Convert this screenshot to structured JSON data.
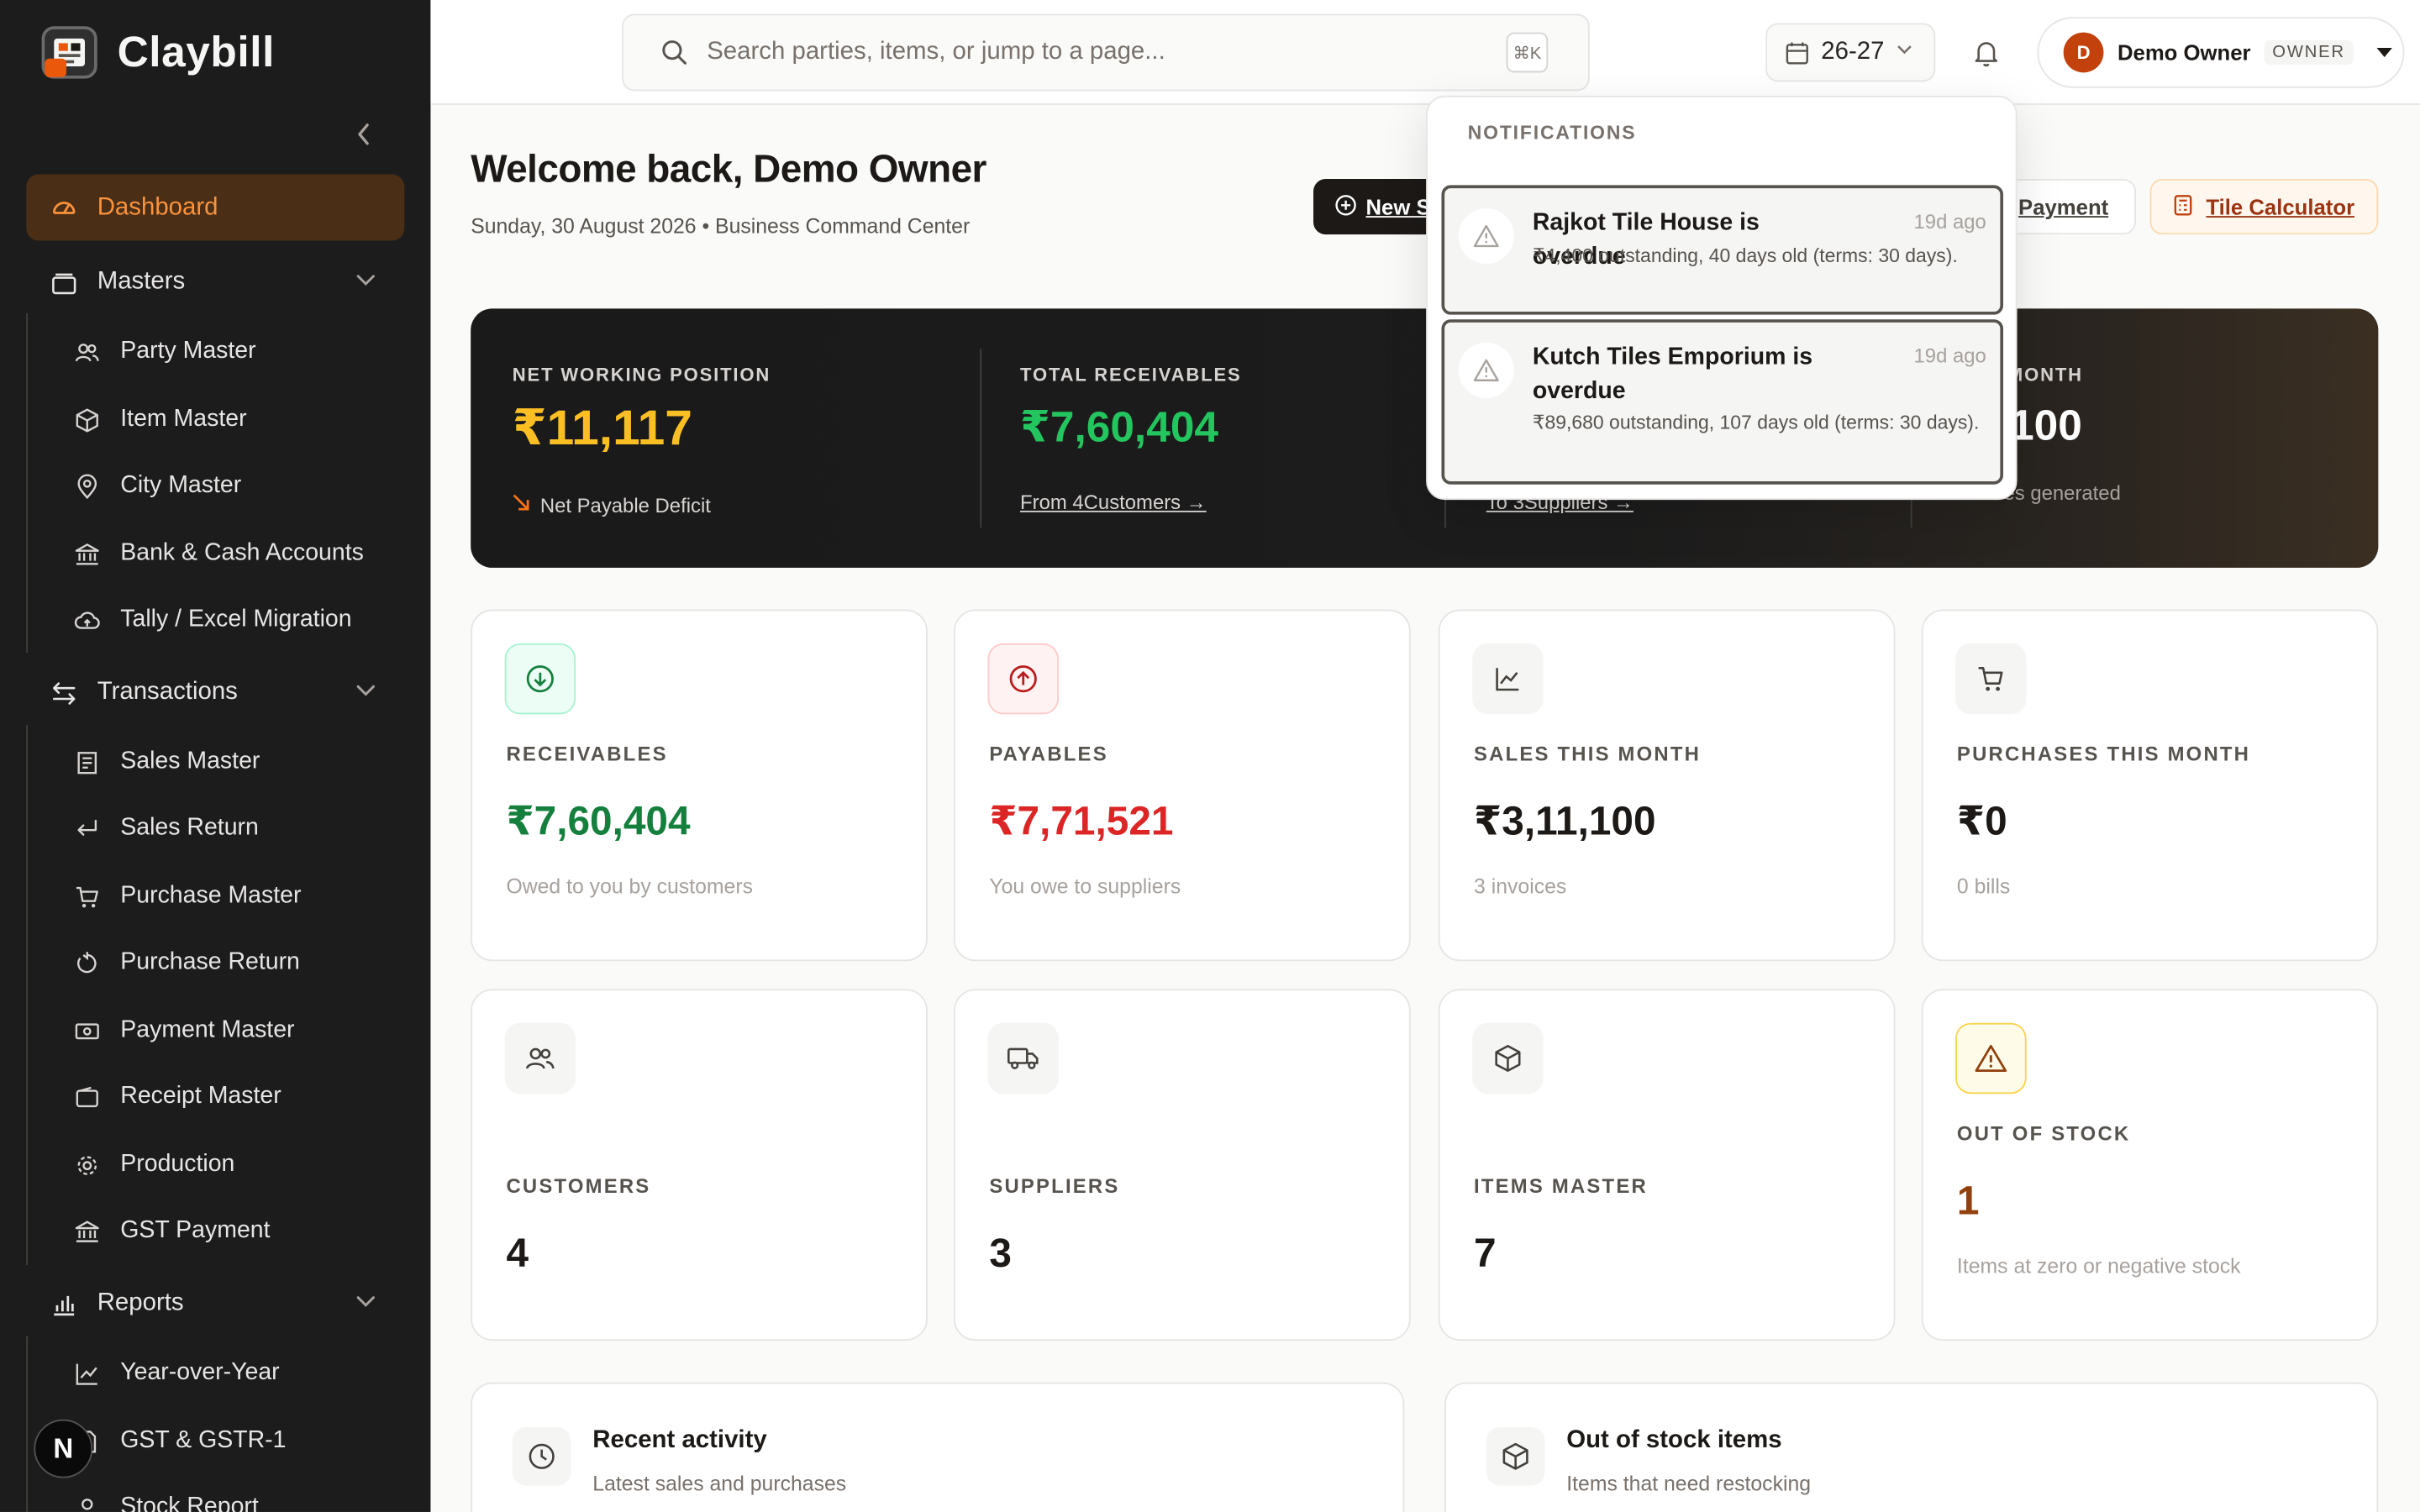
{
  "brand": {
    "name": "Claybill"
  },
  "sidebar": {
    "dashboard": "Dashboard",
    "masters": {
      "label": "Masters",
      "items": [
        "Party Master",
        "Item Master",
        "City Master",
        "Bank & Cash Accounts",
        "Tally / Excel Migration"
      ]
    },
    "transactions": {
      "label": "Transactions",
      "items": [
        "Sales Master",
        "Sales Return",
        "Purchase Master",
        "Purchase Return",
        "Payment Master",
        "Receipt Master",
        "Production",
        "GST Payment"
      ]
    },
    "reports": {
      "label": "Reports",
      "items": [
        "Year-over-Year",
        "GST & GSTR-1",
        "Stock Report"
      ]
    },
    "n_badge": "N"
  },
  "topbar": {
    "search_placeholder": "Search parties, items, or jump to a page...",
    "shortcut": "⌘K",
    "fiscal_year": "26-27",
    "user_initial": "D",
    "user_name": "Demo Owner",
    "user_role": "OWNER"
  },
  "header": {
    "title": "Welcome back, Demo Owner",
    "subtitle": "Sunday, 30 August 2026 • Business Command Center",
    "new_button": "New S",
    "payment_button": "Payment",
    "tile_button": "Tile Calculator"
  },
  "hero": {
    "net": {
      "label": "NET WORKING POSITION",
      "value": "₹11,117",
      "sub": "Net Payable Deficit"
    },
    "receivables": {
      "label": "TOTAL RECEIVABLES",
      "value": "₹7,60,404",
      "sub": "From 4Customers →"
    },
    "payables": {
      "sub": "To 3Suppliers →"
    },
    "sales": {
      "label": "THIS MONTH",
      "value": "11,100",
      "sub": "invoices generated"
    }
  },
  "cards": [
    {
      "label": "RECEIVABLES",
      "value": "₹7,60,404",
      "sub": "Owed to you by customers",
      "icon": "arrow-down-circle-icon"
    },
    {
      "label": "PAYABLES",
      "value": "₹7,71,521",
      "sub": "You owe to suppliers",
      "icon": "arrow-up-circle-icon"
    },
    {
      "label": "SALES THIS MONTH",
      "value": "₹3,11,100",
      "sub": "3 invoices",
      "icon": "trend-chart-icon"
    },
    {
      "label": "PURCHASES THIS MONTH",
      "value": "₹0",
      "sub": "0 bills",
      "icon": "cart-icon"
    },
    {
      "label": "CUSTOMERS",
      "value": "4",
      "icon": "users-icon"
    },
    {
      "label": "SUPPLIERS",
      "value": "3",
      "icon": "truck-icon"
    },
    {
      "label": "ITEMS MASTER",
      "value": "7",
      "icon": "box-icon"
    },
    {
      "label": "OUT OF STOCK",
      "value": "1",
      "sub": "Items at zero or negative stock",
      "icon": "warning-icon"
    }
  ],
  "panels": {
    "recent": {
      "title": "Recent activity",
      "sub": "Latest sales and purchases"
    },
    "oos": {
      "title": "Out of stock items",
      "sub": "Items that need restocking"
    }
  },
  "notifications": {
    "title": "NOTIFICATIONS",
    "items": [
      {
        "title": "Rajkot Tile House is overdue",
        "time": "19d ago",
        "text": "₹4,400 outstanding, 40 days old (terms: 30 days)."
      },
      {
        "title": "Kutch Tiles Emporium is overdue",
        "time": "19d ago",
        "text": "₹89,680 outstanding, 107 days old (terms: 30 days)."
      }
    ]
  },
  "colors": {
    "accent": "#f97316",
    "green": "#15803d",
    "red": "#dc2626",
    "amber": "#fbbf24",
    "sidebar_bg": "#1c1c1c"
  }
}
